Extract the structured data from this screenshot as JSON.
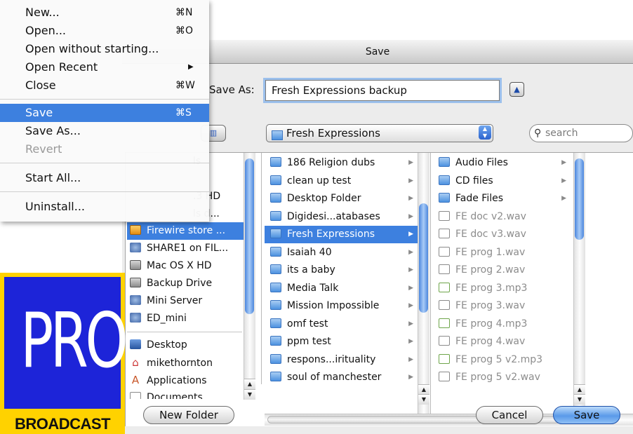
{
  "dialog": {
    "title": "Save",
    "save_as_label": "Save As:",
    "save_as_value": "Fresh Expressions backup",
    "location": "Fresh Expressions",
    "search_placeholder": "search",
    "buttons": {
      "new_folder": "New Folder",
      "cancel": "Cancel",
      "save": "Save"
    }
  },
  "sidebar": {
    "devices": [
      {
        "label": "Firewire store ...",
        "icon": "firewire-drive-icon",
        "selected": true
      },
      {
        "label": "SHARE1 on FIL...",
        "icon": "network-volume-icon"
      },
      {
        "label": "Mac OS X HD",
        "icon": "hard-drive-icon"
      },
      {
        "label": "Backup Drive",
        "icon": "hard-drive-icon"
      },
      {
        "label": "Mini Server",
        "icon": "network-volume-icon"
      },
      {
        "label": "ED_mini",
        "icon": "network-volume-icon"
      }
    ],
    "places": [
      {
        "label": "Desktop",
        "icon": "desktop-icon"
      },
      {
        "label": "mikethornton",
        "icon": "home-icon"
      },
      {
        "label": "Applications",
        "icon": "applications-icon"
      },
      {
        "label": "Documents",
        "icon": "documents-icon"
      }
    ],
    "partial_labels": [
      "ls",
      ".3 HD",
      "ls d..."
    ]
  },
  "column1": [
    {
      "label": "186 Religion dubs"
    },
    {
      "label": "clean up test"
    },
    {
      "label": "Desktop Folder"
    },
    {
      "label": "Digidesi...atabases"
    },
    {
      "label": "Fresh Expressions",
      "selected": true
    },
    {
      "label": "Isaiah 40"
    },
    {
      "label": "its a baby"
    },
    {
      "label": "Media Talk"
    },
    {
      "label": "Mission Impossible"
    },
    {
      "label": "omf test"
    },
    {
      "label": "ppm test"
    },
    {
      "label": "respons...irituality"
    },
    {
      "label": "soul of manchester"
    }
  ],
  "column2": [
    {
      "label": "Audio Files",
      "type": "folder"
    },
    {
      "label": "CD files",
      "type": "folder"
    },
    {
      "label": "Fade Files",
      "type": "folder"
    },
    {
      "label": "FE doc v2.wav",
      "type": "wav"
    },
    {
      "label": "FE doc v3.wav",
      "type": "wav"
    },
    {
      "label": "FE prog 1.wav",
      "type": "wav"
    },
    {
      "label": "FE prog 2.wav",
      "type": "wav"
    },
    {
      "label": "FE prog 3.mp3",
      "type": "mp3"
    },
    {
      "label": "FE prog 3.wav",
      "type": "wav"
    },
    {
      "label": "FE prog 4.mp3",
      "type": "mp3"
    },
    {
      "label": "FE prog 4.wav",
      "type": "wav"
    },
    {
      "label": "FE prog 5 v2.mp3",
      "type": "mp3"
    },
    {
      "label": "FE prog 5 v2.wav",
      "type": "wav"
    }
  ],
  "menu": {
    "items": [
      {
        "label": "New...",
        "shortcut": "⌘N"
      },
      {
        "label": "Open...",
        "shortcut": "⌘O"
      },
      {
        "label": "Open without starting...",
        "shortcut": ""
      },
      {
        "label": "Open Recent",
        "shortcut": "",
        "submenu": "▶"
      },
      {
        "label": "Close",
        "shortcut": "⌘W"
      },
      {
        "label": "Save",
        "shortcut": "⌘S",
        "highlighted": true
      },
      {
        "label": "Save As...",
        "shortcut": ""
      },
      {
        "label": "Revert",
        "shortcut": "",
        "disabled": true
      },
      {
        "label": "Start All...",
        "shortcut": ""
      },
      {
        "label": "Uninstall...",
        "shortcut": ""
      }
    ]
  },
  "logo": {
    "mark": "PRO",
    "wordmark": "BROADCAST"
  },
  "colors": {
    "selection": "#3d80df",
    "logo_yellow": "#ffd200",
    "logo_blue": "#1d24d8"
  }
}
